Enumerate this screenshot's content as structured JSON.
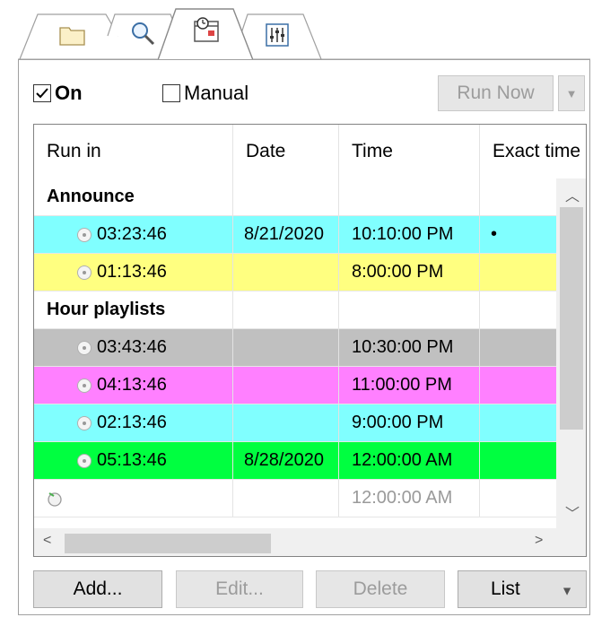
{
  "tabs": [
    {
      "icon": "folder-icon"
    },
    {
      "icon": "search-icon"
    },
    {
      "icon": "schedule-clock-icon",
      "active": true
    },
    {
      "icon": "equalizer-icon"
    }
  ],
  "toolbar": {
    "on_label": "On",
    "on_checked": true,
    "manual_label": "Manual",
    "manual_checked": false,
    "run_now_label": "Run Now"
  },
  "grid": {
    "columns": [
      "Run in",
      "Date",
      "Time",
      "Exact time"
    ],
    "groups": [
      {
        "title": "Announce",
        "rows": [
          {
            "run_in": "03:23:46",
            "date": "8/21/2020",
            "time": "10:10:00 PM",
            "exact": "•",
            "color": "#80ffff"
          },
          {
            "run_in": "01:13:46",
            "date": "",
            "time": "8:00:00 PM",
            "exact": "",
            "color": "#ffff80"
          }
        ]
      },
      {
        "title": "Hour playlists",
        "rows": [
          {
            "run_in": "03:43:46",
            "date": "",
            "time": "10:30:00 PM",
            "exact": "",
            "color": "#c0c0c0"
          },
          {
            "run_in": "04:13:46",
            "date": "",
            "time": "11:00:00 PM",
            "exact": "",
            "color": "#ff80ff"
          },
          {
            "run_in": "02:13:46",
            "date": "",
            "time": "9:00:00 PM",
            "exact": "",
            "color": "#80ffff"
          },
          {
            "run_in": "05:13:46",
            "date": "8/28/2020",
            "time": "12:00:00 AM",
            "exact": "",
            "color": "#00ff40"
          }
        ]
      }
    ],
    "extra_row": {
      "time": "12:00:00 AM"
    }
  },
  "buttons": {
    "add": "Add...",
    "edit": "Edit...",
    "delete": "Delete",
    "list": "List"
  }
}
